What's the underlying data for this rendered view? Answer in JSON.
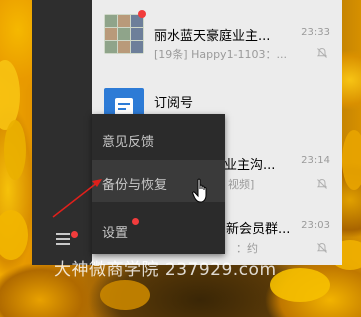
{
  "colors": {
    "sidebar_bg": "#2e2e2e",
    "list_bg": "#ececec",
    "menu_bg": "#2b2b2b",
    "menu_hover_bg": "#3a3a3a",
    "badge_red": "#f23c3c",
    "annotation_red": "#e0201b"
  },
  "chats": [
    {
      "name": "丽水蓝天豪庭业主...",
      "preview": "[19条] Happy1-1103：...",
      "time": "23:33",
      "muted": true,
      "unread_dot": true,
      "avatar_type": "group"
    },
    {
      "name": "订阅号",
      "preview": "",
      "time": "",
      "muted": false,
      "unread_dot": false,
      "avatar_type": "subscription"
    },
    {
      "name": "业主沟...",
      "preview": "视频]",
      "time": "23:14",
      "muted": true,
      "unread_dot": false,
      "avatar_type": "group"
    },
    {
      "name": "新会员群...",
      "preview": "：约",
      "time": "23:03",
      "muted": true,
      "unread_dot": false,
      "avatar_type": "group"
    }
  ],
  "menu": {
    "items": [
      {
        "label": "意见反馈",
        "hovered": false,
        "dot": false
      },
      {
        "label": "备份与恢复",
        "hovered": true,
        "dot": false
      },
      {
        "label": "设置",
        "hovered": false,
        "dot": true
      }
    ]
  },
  "sidebar": {
    "menu_icon": "hamburger-icon",
    "menu_dot": true
  },
  "annotation": {
    "type": "red-arrow",
    "target": "backup-restore-menu-item"
  },
  "watermark": {
    "text": "大神微商学院 237929.com"
  },
  "cursor": {
    "type": "hand-pointer-icon"
  }
}
